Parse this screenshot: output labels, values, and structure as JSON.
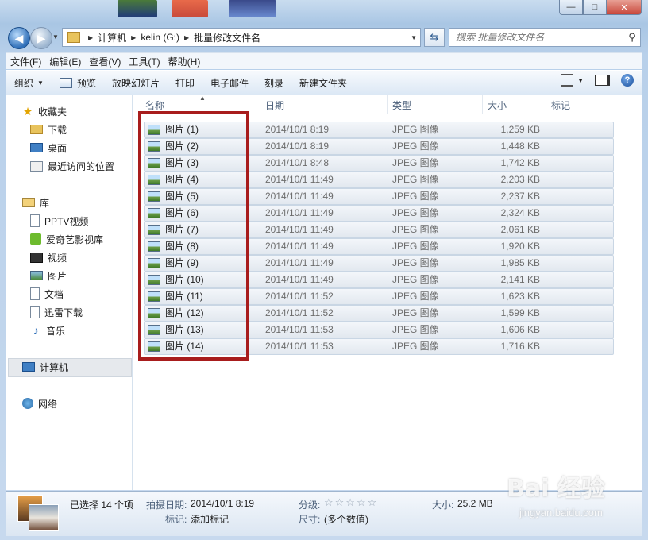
{
  "window": {
    "minimize_icon": "minimize-icon",
    "maximize_icon": "maximize-icon",
    "close_icon": "close-icon",
    "minimize_glyph": "—",
    "maximize_glyph": "□",
    "close_glyph": "✕"
  },
  "address": {
    "crumbs": [
      "计算机",
      "kelin (G:)",
      "批量修改文件名"
    ],
    "search_placeholder": "搜索 批量修改文件名"
  },
  "menu": [
    "文件(F)",
    "编辑(E)",
    "查看(V)",
    "工具(T)",
    "帮助(H)"
  ],
  "toolbar": {
    "organize": "组织",
    "preview": "预览",
    "slideshow": "放映幻灯片",
    "print": "打印",
    "email": "电子邮件",
    "burn": "刻录",
    "new_folder": "新建文件夹"
  },
  "sidebar": {
    "favorites": "收藏夹",
    "downloads": "下载",
    "desktop": "桌面",
    "recent": "最近访问的位置",
    "libraries": "库",
    "pptv": "PPTV视频",
    "iqiyi": "爱奇艺影视库",
    "videos": "视频",
    "pictures": "图片",
    "documents": "文档",
    "xunlei": "迅雷下载",
    "music": "音乐",
    "computer": "计算机",
    "network": "网络"
  },
  "columns": {
    "name": "名称",
    "date": "日期",
    "type": "类型",
    "size": "大小",
    "tags": "标记"
  },
  "files": [
    {
      "name": "图片 (1)",
      "date": "2014/10/1 8:19",
      "type": "JPEG 图像",
      "size": "1,259 KB"
    },
    {
      "name": "图片 (2)",
      "date": "2014/10/1 8:19",
      "type": "JPEG 图像",
      "size": "1,448 KB"
    },
    {
      "name": "图片 (3)",
      "date": "2014/10/1 8:48",
      "type": "JPEG 图像",
      "size": "1,742 KB"
    },
    {
      "name": "图片 (4)",
      "date": "2014/10/1 11:49",
      "type": "JPEG 图像",
      "size": "2,203 KB"
    },
    {
      "name": "图片 (5)",
      "date": "2014/10/1 11:49",
      "type": "JPEG 图像",
      "size": "2,237 KB"
    },
    {
      "name": "图片 (6)",
      "date": "2014/10/1 11:49",
      "type": "JPEG 图像",
      "size": "2,324 KB"
    },
    {
      "name": "图片 (7)",
      "date": "2014/10/1 11:49",
      "type": "JPEG 图像",
      "size": "2,061 KB"
    },
    {
      "name": "图片 (8)",
      "date": "2014/10/1 11:49",
      "type": "JPEG 图像",
      "size": "1,920 KB"
    },
    {
      "name": "图片 (9)",
      "date": "2014/10/1 11:49",
      "type": "JPEG 图像",
      "size": "1,985 KB"
    },
    {
      "name": "图片 (10)",
      "date": "2014/10/1 11:49",
      "type": "JPEG 图像",
      "size": "2,141 KB"
    },
    {
      "name": "图片 (11)",
      "date": "2014/10/1 11:52",
      "type": "JPEG 图像",
      "size": "1,623 KB"
    },
    {
      "name": "图片 (12)",
      "date": "2014/10/1 11:52",
      "type": "JPEG 图像",
      "size": "1,599 KB"
    },
    {
      "name": "图片 (13)",
      "date": "2014/10/1 11:53",
      "type": "JPEG 图像",
      "size": "1,606 KB"
    },
    {
      "name": "图片 (14)",
      "date": "2014/10/1 11:53",
      "type": "JPEG 图像",
      "size": "1,716 KB"
    }
  ],
  "details": {
    "selected": "已选择 14 个项",
    "date_label": "拍摄日期:",
    "date_value": "2014/10/1 8:19",
    "tags_label": "标记:",
    "tags_value": "添加标记",
    "rating_label": "分级:",
    "rating_stars": "☆☆☆☆☆",
    "dims_label": "尺寸:",
    "dims_value": "(多个数值)",
    "size_label": "大小:",
    "size_value": "25.2 MB"
  },
  "watermark": {
    "main": "Bai 经验",
    "sub": "jingyan.baidu.com"
  },
  "colors": {
    "highlight_border": "#a81d1d",
    "frame": "#b8d0ea"
  }
}
